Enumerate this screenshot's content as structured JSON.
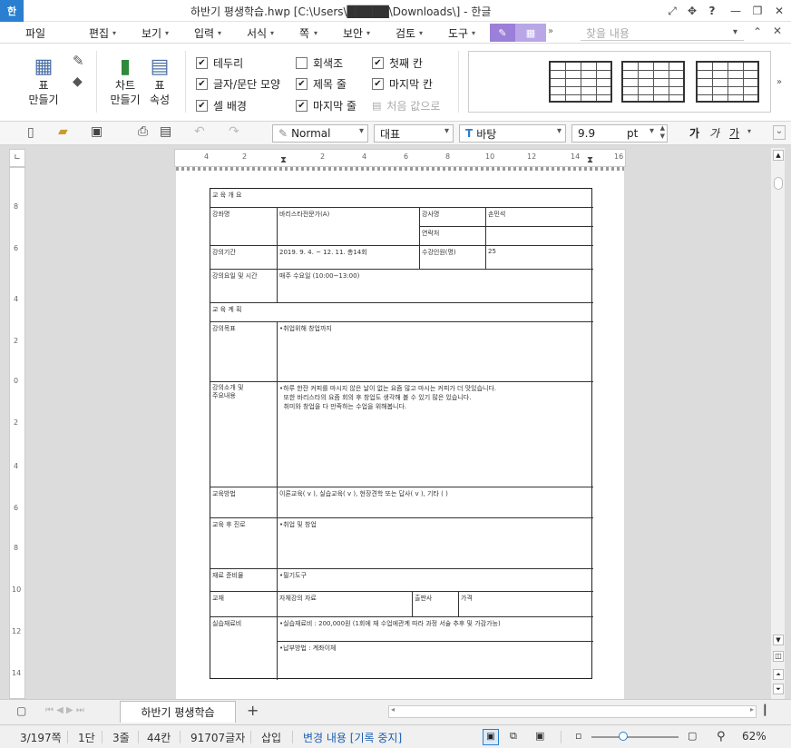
{
  "window": {
    "title": "하반기 평생학습.hwp [C:\\Users\\█████\\Downloads\\] - 한글",
    "logo": "한"
  },
  "menubar": {
    "items": [
      "파일",
      "편집",
      "보기",
      "입력",
      "서식",
      "쪽",
      "보안",
      "검토",
      "도구"
    ],
    "search_placeholder": "찾을 내용"
  },
  "ribbon": {
    "table_create": "표\n만들기",
    "chart_create": "차트\n만들기",
    "table_props": "표\n속성",
    "checks": [
      {
        "label": "테두리",
        "checked": true
      },
      {
        "label": "글자/문단 모양",
        "checked": true
      },
      {
        "label": "셀 배경",
        "checked": true
      },
      {
        "label": "회색조",
        "checked": false
      },
      {
        "label": "제목 줄",
        "checked": true
      },
      {
        "label": "마지막 줄",
        "checked": true
      },
      {
        "label": "첫째 칸",
        "checked": true
      },
      {
        "label": "마지막 칸",
        "checked": true
      },
      {
        "label": "처음 값으로",
        "checked": false
      }
    ]
  },
  "toolbar": {
    "style": "Normal",
    "para_style": "대표",
    "font": "바탕",
    "font_size": "9.9",
    "unit": "pt",
    "format_buttons": [
      "가",
      "가",
      "가"
    ]
  },
  "ruler": {
    "h_ticks": [
      "4",
      "2",
      "2",
      "4",
      "6",
      "8",
      "10",
      "12",
      "14",
      "16"
    ],
    "v_ticks": [
      "8",
      "6",
      "4",
      "2",
      "0",
      "2",
      "4",
      "6",
      "8",
      "10",
      "12",
      "14"
    ]
  },
  "document": {
    "sections": {
      "overview": "교 육 개 요",
      "plan": "교 육 계 획"
    },
    "labels": {
      "course": "강좌명",
      "instructor": "강사명",
      "contact": "연락처",
      "period": "강의기간",
      "capacity": "수강인원(명)",
      "time": "강의요일 및 시간",
      "goal": "강의목표",
      "content": "강의소개 및\n주요내용",
      "method": "교육방법",
      "after": "교육 후 진로",
      "materials": "재료 준비물",
      "textbook": "교재",
      "publisher": "출판사",
      "price": "가격",
      "cost": "실습재료비"
    },
    "values": {
      "course": "바리스타전문가(A)",
      "instructor": "손민석",
      "period": "2019. 9. 4. ~ 12. 11. 총14회",
      "capacity": "25",
      "time": "매주 수요일 (10:00~13:00)",
      "goal": "•취업위해 창업까지",
      "content_l1": "•하루 한잔 커피를 마시지 않은 날이 없는 요즘 많고 마시는 커피가 더 맛있습니다.",
      "content_l2": "  또한 바리스타의 요즘 회의 후 창업도 생각해 볼 수 있기 많은 있습니다.",
      "content_l3": "  취미와 창업을 다 만족하는 수업을 위해봅니다.",
      "method": "이론교육( v ), 실습교육( v ), 현장견학 또는 답사( v ), 기타 (     )",
      "after": "•취업 및 창업",
      "materials": "•필기도구",
      "textbook": "자체강의 자료",
      "cost_l1": "•실습재료비 : 200,000원 (1회에 재 수업에관계 따라 과정 서술 추후 및 가감가능)",
      "cost_l2": "•납부방법 : 계좌이체"
    }
  },
  "tabs": {
    "doc_tab": "하반기 평생학습",
    "add": "+"
  },
  "status": {
    "page": "3/197쪽",
    "column": "1단",
    "line": "3줄",
    "col": "44칸",
    "chars": "91707글자",
    "mode": "삽입",
    "track": "변경 내용 [기록 중지]",
    "zoom": "62%"
  },
  "colors": {
    "accent": "#2a7fd0",
    "menu_highlight": "#9b7fd8",
    "track_text": "#1a5fb4"
  }
}
